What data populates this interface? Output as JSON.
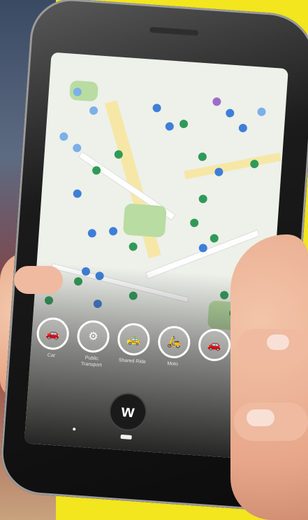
{
  "scene": {
    "background_color": "#f3e51e",
    "accent_map_blue": "#3d7fd8",
    "accent_map_green": "#2f9a57"
  },
  "statusbar": {
    "left": "",
    "right": ""
  },
  "map": {
    "markers": [
      {
        "color": "lblue"
      },
      {
        "color": "blue"
      },
      {
        "color": "green"
      },
      {
        "color": "purple"
      },
      {
        "color": "blue"
      },
      {
        "color": "green"
      },
      {
        "color": "lblue"
      },
      {
        "color": "blue"
      }
    ]
  },
  "categories": [
    {
      "icon": "car-icon",
      "label": "Car"
    },
    {
      "icon": "bike-icon",
      "label": "Public Transport"
    },
    {
      "icon": "scooter-icon",
      "label": "Shared Ride"
    },
    {
      "icon": "moped-icon",
      "label": "Moto"
    },
    {
      "icon": "more-icon",
      "label": ""
    }
  ],
  "app": {
    "logo_letter": "w"
  }
}
